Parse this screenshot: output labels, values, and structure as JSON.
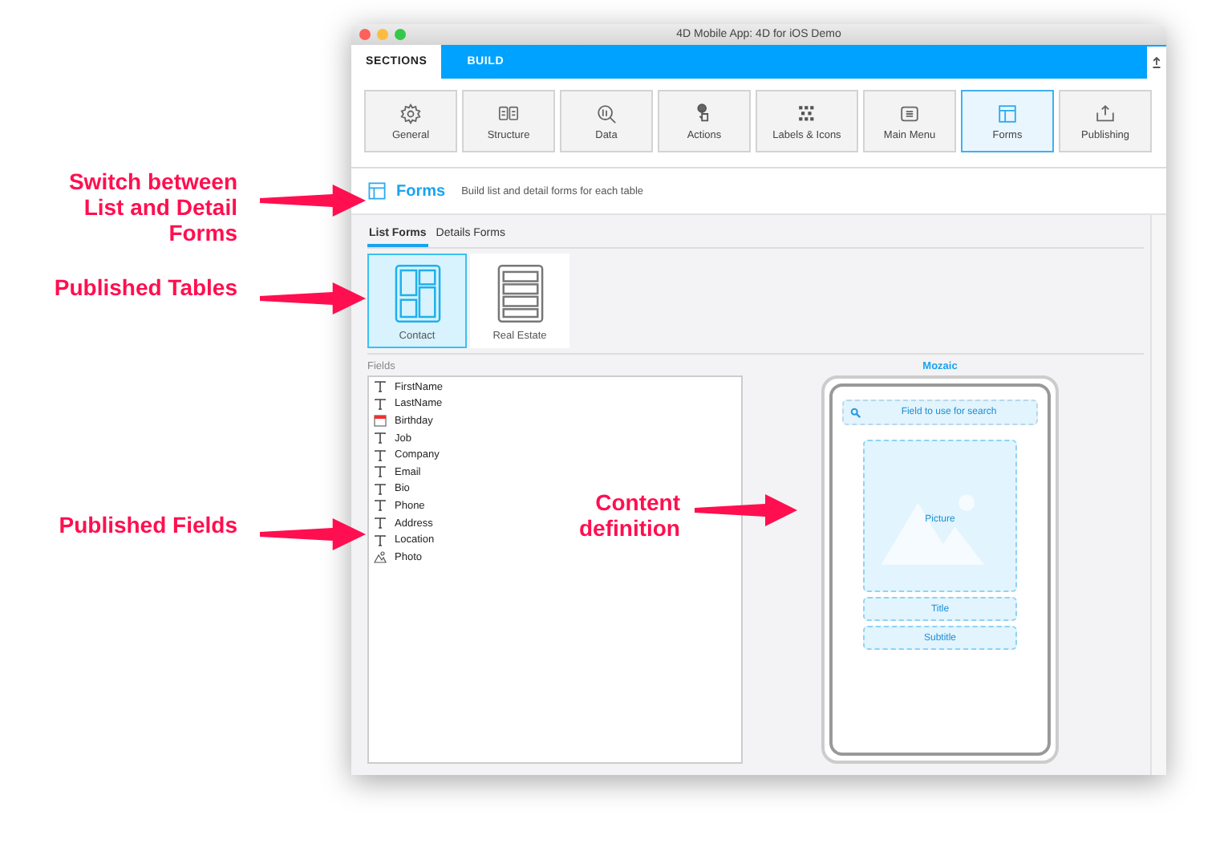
{
  "window": {
    "title": "4D Mobile App: 4D for iOS Demo"
  },
  "top_tabs": [
    {
      "label": "SECTIONS",
      "selected": true
    },
    {
      "label": "BUILD",
      "selected": false
    }
  ],
  "sections": [
    {
      "label": "General",
      "selected": false
    },
    {
      "label": "Structure",
      "selected": false
    },
    {
      "label": "Data",
      "selected": false
    },
    {
      "label": "Actions",
      "selected": false
    },
    {
      "label": "Labels & Icons",
      "selected": false
    },
    {
      "label": "Main Menu",
      "selected": false
    },
    {
      "label": "Forms",
      "selected": true
    },
    {
      "label": "Publishing",
      "selected": false
    }
  ],
  "header": {
    "title": "Forms",
    "description": "Build list and detail forms for each table"
  },
  "form_tabs": [
    {
      "label": "List Forms",
      "selected": true
    },
    {
      "label": "Details Forms",
      "selected": false
    }
  ],
  "tables": [
    {
      "name": "Contact",
      "selected": true
    },
    {
      "name": "Real Estate",
      "selected": false
    }
  ],
  "fields": {
    "label": "Fields",
    "items": [
      {
        "name": "FirstName",
        "kind": "text"
      },
      {
        "name": "LastName",
        "kind": "text"
      },
      {
        "name": "Birthday",
        "kind": "date"
      },
      {
        "name": "Job",
        "kind": "text"
      },
      {
        "name": "Company",
        "kind": "text"
      },
      {
        "name": "Email",
        "kind": "text"
      },
      {
        "name": "Bio",
        "kind": "text"
      },
      {
        "name": "Phone",
        "kind": "text"
      },
      {
        "name": "Address",
        "kind": "text"
      },
      {
        "name": "Location",
        "kind": "text"
      },
      {
        "name": "Photo",
        "kind": "picture"
      }
    ]
  },
  "template": {
    "name": "Mozaic",
    "search": "Field to use for search",
    "picture": "Picture",
    "title": "Title",
    "subtitle": "Subtitle"
  },
  "annotations": [
    {
      "text": "Switch between List and Detail Forms"
    },
    {
      "text": "Published Tables"
    },
    {
      "text": "Published Fields"
    },
    {
      "text": "Content definition"
    }
  ]
}
